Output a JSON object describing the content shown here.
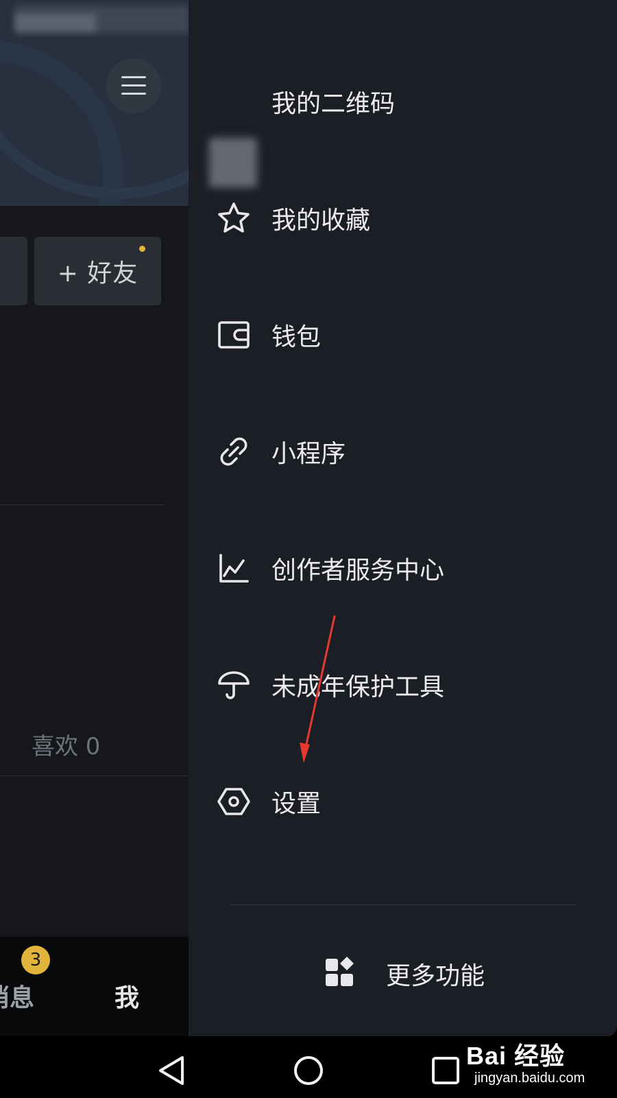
{
  "profile_background": {
    "add_friend_label": "+ 好友",
    "likes_label": "喜欢 0",
    "bottom_nav": {
      "messages_label": "消息",
      "messages_badge": "3",
      "me_label": "我"
    }
  },
  "drawer": {
    "menu_items": [
      {
        "label": "我的二维码",
        "icon": "qr-avatar-icon"
      },
      {
        "label": "我的收藏",
        "icon": "star-icon"
      },
      {
        "label": "钱包",
        "icon": "wallet-icon"
      },
      {
        "label": "小程序",
        "icon": "link-icon"
      },
      {
        "label": "创作者服务中心",
        "icon": "chart-line-icon"
      },
      {
        "label": "未成年保护工具",
        "icon": "umbrella-icon"
      },
      {
        "label": "设置",
        "icon": "hexagon-settings-icon"
      }
    ],
    "more_features_label": "更多功能"
  },
  "system_nav": {
    "buttons": [
      "back-icon",
      "home-icon",
      "recent-apps-icon"
    ]
  },
  "watermark": {
    "brand": "Bai 经验",
    "url": "jingyan.baidu.com"
  },
  "colors": {
    "accent": "#e1b43b",
    "annotation_arrow": "#e23a2e",
    "drawer_bg": "#1c1e26"
  }
}
